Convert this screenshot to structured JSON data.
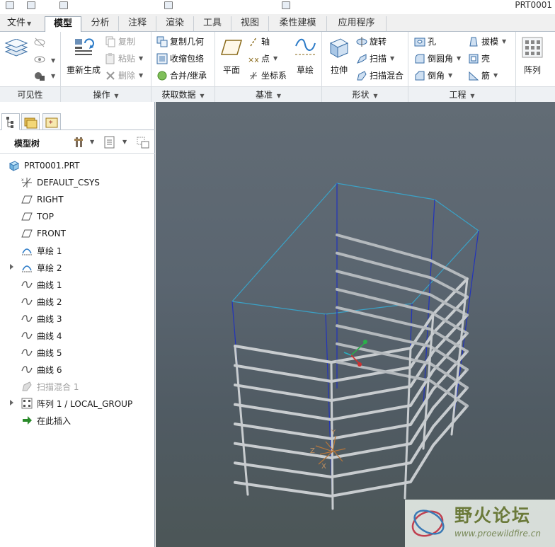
{
  "window": {
    "title": "PRT0001"
  },
  "menubar": {
    "file": "文件",
    "tabs": [
      "模型",
      "分析",
      "注释",
      "渲染",
      "工具",
      "视图",
      "柔性建模",
      "应用程序"
    ],
    "active_tab": "模型"
  },
  "ribbon": {
    "visibility": {
      "label": "可见性"
    },
    "operations": {
      "label": "操作",
      "regenerate": "重新生成",
      "copy": "复制",
      "paste": "粘贴",
      "delete": "删除"
    },
    "get_data": {
      "label": "获取数据",
      "copy_geometry": "复制几何",
      "shrinkwrap": "收缩包络",
      "merge": "合并/继承"
    },
    "datum": {
      "label": "基准",
      "plane": "平面",
      "axis": "轴",
      "point": "点",
      "csys": "坐标系",
      "sketch": "草绘"
    },
    "shapes": {
      "label": "形状",
      "extrude": "拉伸",
      "revolve": "旋转",
      "sweep": "扫描",
      "swept_blend": "扫描混合"
    },
    "engineering": {
      "label": "工程",
      "hole": "孔",
      "draft": "拔模",
      "round": "倒圆角",
      "shell": "壳",
      "chamfer": "倒角",
      "rib": "筋"
    },
    "pattern": {
      "label": "阵列"
    }
  },
  "model_tree": {
    "title": "模型树",
    "items": [
      {
        "label": "PRT0001.PRT",
        "icon": "part-icon",
        "expandable": false,
        "suppressed": false
      },
      {
        "label": "DEFAULT_CSYS",
        "icon": "csys-icon",
        "expandable": false,
        "suppressed": false
      },
      {
        "label": "RIGHT",
        "icon": "datum-plane-icon",
        "expandable": false,
        "suppressed": false
      },
      {
        "label": "TOP",
        "icon": "datum-plane-icon",
        "expandable": false,
        "suppressed": false
      },
      {
        "label": "FRONT",
        "icon": "datum-plane-icon",
        "expandable": false,
        "suppressed": false
      },
      {
        "label": "草绘 1",
        "icon": "sketch-icon",
        "expandable": false,
        "suppressed": false
      },
      {
        "label": "草绘 2",
        "icon": "sketch-icon",
        "expandable": true,
        "suppressed": false
      },
      {
        "label": "曲线 1",
        "icon": "curve-icon",
        "expandable": false,
        "suppressed": false
      },
      {
        "label": "曲线 2",
        "icon": "curve-icon",
        "expandable": false,
        "suppressed": false
      },
      {
        "label": "曲线 3",
        "icon": "curve-icon",
        "expandable": false,
        "suppressed": false
      },
      {
        "label": "曲线 4",
        "icon": "curve-icon",
        "expandable": false,
        "suppressed": false
      },
      {
        "label": "曲线 5",
        "icon": "curve-icon",
        "expandable": false,
        "suppressed": false
      },
      {
        "label": "曲线 6",
        "icon": "curve-icon",
        "expandable": false,
        "suppressed": false
      },
      {
        "label": "扫描混合 1",
        "icon": "swept-blend-icon",
        "expandable": false,
        "suppressed": true
      },
      {
        "label": "阵列 1 / LOCAL_GROUP",
        "icon": "pattern-icon",
        "expandable": true,
        "suppressed": false
      },
      {
        "label": "在此插入",
        "icon": "insert-here-icon",
        "expandable": false,
        "suppressed": false
      }
    ]
  },
  "viewport": {
    "axis_labels": {
      "y": "Y",
      "z": "Z",
      "x": "X"
    }
  },
  "watermark": {
    "title": "野火论坛",
    "url": "www.proewildfire.cn"
  }
}
